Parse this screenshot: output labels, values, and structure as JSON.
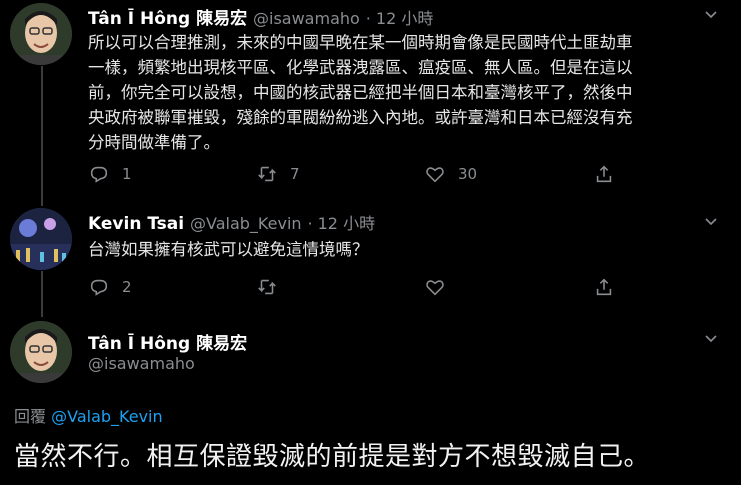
{
  "tweets": [
    {
      "name": "Tân Ī Hông 陳易宏",
      "handle": "@isawamaho",
      "time": "· 12 小時",
      "text_lines": [
        "所以可以合理推測，未來的中國早晚在某一個時期會像是民國時代土匪劫車",
        "一樣，頻繁地出現核平區、化學武器洩露區、瘟疫區、無人區。但是在這以",
        "前，你完全可以設想，中國的核武器已經把半個日本和臺灣核平了，然後中",
        "央政府被聯軍摧毀，殘餘的軍閥紛紛逃入內地。或許臺灣和日本已經沒有充",
        "分時間做準備了。"
      ],
      "reply_count": "1",
      "retweet_count": "7",
      "like_count": "30"
    },
    {
      "name": "Kevin Tsai",
      "handle": "@Valab_Kevin",
      "time": "· 12 小時",
      "text_lines": [
        "台灣如果擁有核武可以避免這情境嗎？"
      ],
      "reply_count": "2",
      "retweet_count": "",
      "like_count": ""
    }
  ],
  "main_tweet": {
    "name": "Tân Ī Hông 陳易宏",
    "handle": "@isawamaho",
    "reply_label": "回覆",
    "reply_target": "@Valab_Kevin",
    "text": "當然不行。相互保證毀滅的前提是對方不想毀滅自己。"
  },
  "icons": [
    "reply-icon",
    "retweet-icon",
    "like-icon",
    "share-icon",
    "chevron-down-icon"
  ],
  "colors": {
    "background": "#000000",
    "link": "#1da1f2",
    "muted": "#8a8d91"
  }
}
